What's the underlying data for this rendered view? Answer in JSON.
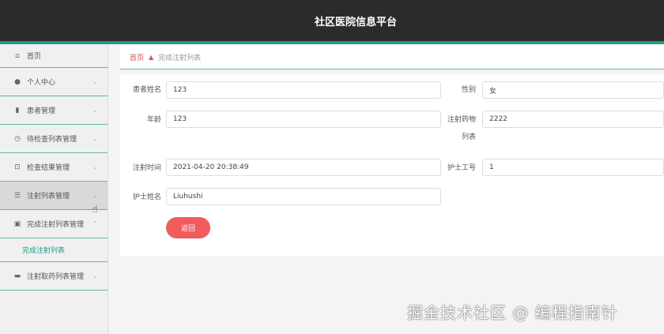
{
  "header": {
    "title": "社区医院信息平台"
  },
  "sidebar": {
    "items": [
      {
        "label": "首页",
        "icon": "home-icon",
        "glyph": "⌂"
      },
      {
        "label": "个人中心",
        "icon": "user-icon",
        "glyph": "👤"
      },
      {
        "label": "患者管理",
        "icon": "chart-icon",
        "glyph": "▮"
      },
      {
        "label": "待检查列表管理",
        "icon": "clock-icon",
        "glyph": "◷"
      },
      {
        "label": "检查结果管理",
        "icon": "crop-icon",
        "glyph": "⊡"
      },
      {
        "label": "注射列表管理",
        "icon": "list-icon",
        "glyph": "☰"
      },
      {
        "label": "完成注射列表管理",
        "icon": "clipboard-icon",
        "glyph": "▣"
      },
      {
        "label": "注射取药列表管理",
        "icon": "monitor-icon",
        "glyph": "▬"
      }
    ],
    "submenu_label": "完成注射列表"
  },
  "breadcrumb": {
    "home": "首页",
    "current": "完成注射列表"
  },
  "form": {
    "patient_name_label": "患者姓名",
    "patient_name_value": "123",
    "gender_label": "性别",
    "gender_value": "女",
    "age_label": "年龄",
    "age_value": "123",
    "drug_list_label_1": "注射药物",
    "drug_list_label_2": "列表",
    "drug_list_value": "2222",
    "inject_time_label": "注射时间",
    "inject_time_value": "2021-04-20 20:38:49",
    "nurse_id_label": "护士工号",
    "nurse_id_value": "1",
    "nurse_name_label": "护士姓名",
    "nurse_name_value": "Liuhushi",
    "back_label": "返回"
  },
  "watermark": "掘金技术社区 @ 编程指南针",
  "colors": {
    "accent": "#1a9c8c",
    "header": "#2b2b2b",
    "button": "#f25b5b"
  }
}
